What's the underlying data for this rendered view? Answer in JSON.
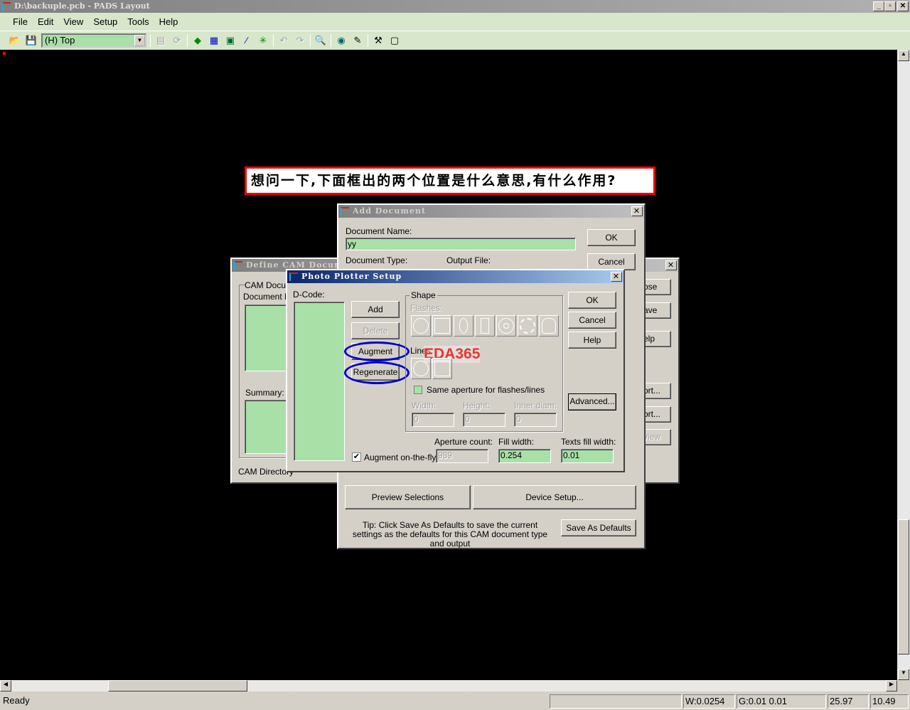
{
  "window": {
    "title": "D:\\backuple.pcb - PADS Layout",
    "min": "_",
    "max": "▫",
    "close": "✕"
  },
  "menu": [
    "File",
    "Edit",
    "View",
    "Setup",
    "Tools",
    "Help"
  ],
  "toolbar": {
    "layer_select": "(H) Top",
    "icons": [
      "open-icon",
      "save-icon",
      "properties-icon",
      "refresh-icon",
      "add-component-icon",
      "route-icon",
      "board-icon",
      "connection-icon",
      "pin-icon",
      "undo-icon",
      "redo-icon",
      "zoom-icon",
      "view-icon",
      "paint-icon",
      "hammer-icon",
      "window-icon"
    ]
  },
  "annotation": "想问一下,下面框出的两个位置是什么意思,有什么作用?",
  "watermark": "EDA365",
  "define_cam": {
    "title": "Define CAM Document",
    "group": "CAM Docum",
    "doc_name": "Document N",
    "summary": "Summary:",
    "cam_dir": "CAM Directory",
    "buttons": [
      "ose",
      "ave",
      "elp",
      "...",
      "ort...",
      "ort...",
      "view"
    ]
  },
  "add_doc": {
    "title": "Add Document",
    "doc_name_label": "Document Name:",
    "doc_name": "yy",
    "doc_type_label": "Document Type:",
    "output_file_label": "Output File:",
    "ok": "OK",
    "cancel": "Cancel",
    "preview": "Preview Selections",
    "device": "Device Setup...",
    "tip": "Tip: Click Save As Defaults to save the current settings as the defaults for this CAM document type and output",
    "save_defaults": "Save As Defaults"
  },
  "photo": {
    "title": "Photo Plotter Setup",
    "dcode": "D-Code:",
    "add": "Add",
    "delete": "Delete",
    "augment": "Augment",
    "regenerate": "Regenerate",
    "shape": "Shape",
    "flashes": "Flashes:",
    "lines": "Lines:",
    "same_aperture": "Same aperture for flashes/lines",
    "width_label": "Width:",
    "height_label": "Height:",
    "inner_label": "Inner diam:",
    "width": "0",
    "height": "0",
    "inner": "0",
    "ok": "OK",
    "cancel": "Cancel",
    "help": "Help",
    "advanced": "Advanced...",
    "augment_fly": "Augment on-the-fly",
    "augment_fly_checked": true,
    "aperture_count_label": "Aperture count:",
    "aperture_count": "989",
    "fill_width_label": "Fill width:",
    "fill_width": "0.254",
    "text_fill_label": "Texts fill width:",
    "text_fill": "0.01"
  },
  "status": {
    "ready": "Ready",
    "width": "W:0.0254",
    "grid": "G:0.01 0.01",
    "x": "25.97",
    "y": "10.49"
  },
  "scroll": {
    "up": "▲",
    "down": "▼",
    "left": "◀",
    "right": "▶"
  }
}
